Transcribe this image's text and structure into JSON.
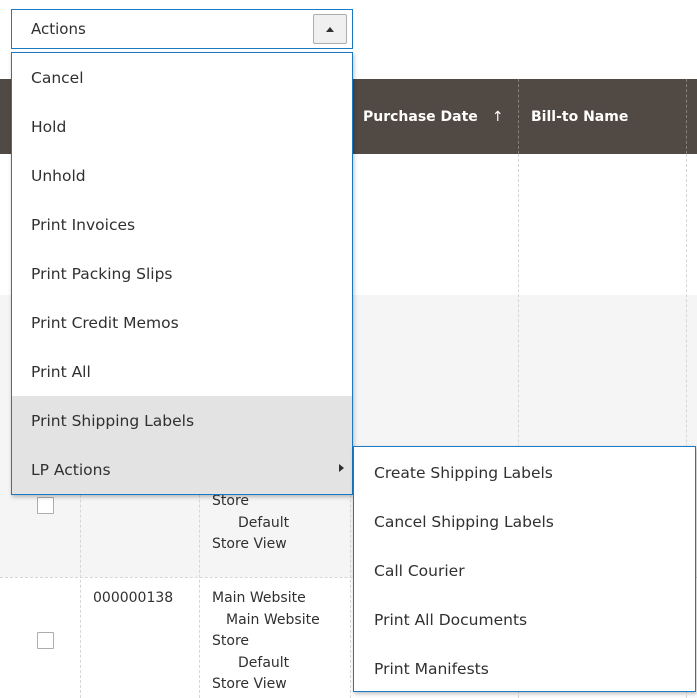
{
  "actions": {
    "label": "Actions",
    "items": [
      {
        "label": "Cancel"
      },
      {
        "label": "Hold"
      },
      {
        "label": "Unhold"
      },
      {
        "label": "Print Invoices"
      },
      {
        "label": "Print Packing Slips"
      },
      {
        "label": "Print Credit Memos"
      },
      {
        "label": "Print All"
      },
      {
        "label": "Print Shipping Labels"
      },
      {
        "label": "LP Actions"
      }
    ],
    "submenu": [
      {
        "label": "Create Shipping Labels"
      },
      {
        "label": "Cancel Shipping Labels"
      },
      {
        "label": "Call Courier"
      },
      {
        "label": "Print All Documents"
      },
      {
        "label": "Print Manifests"
      }
    ]
  },
  "grid": {
    "headers": {
      "purchase_date": "Purchase Date",
      "sort_arrow": "↑",
      "bill_to_name": "Bill-to Name"
    },
    "rows": [
      {
        "purchase_point_lines": [
          "Store",
          "Default",
          "Store View"
        ]
      },
      {
        "id": "000000138",
        "purchase_point_lines": [
          "Main Website",
          "Main Website",
          "Store",
          "Default",
          "Store View"
        ]
      }
    ]
  }
}
